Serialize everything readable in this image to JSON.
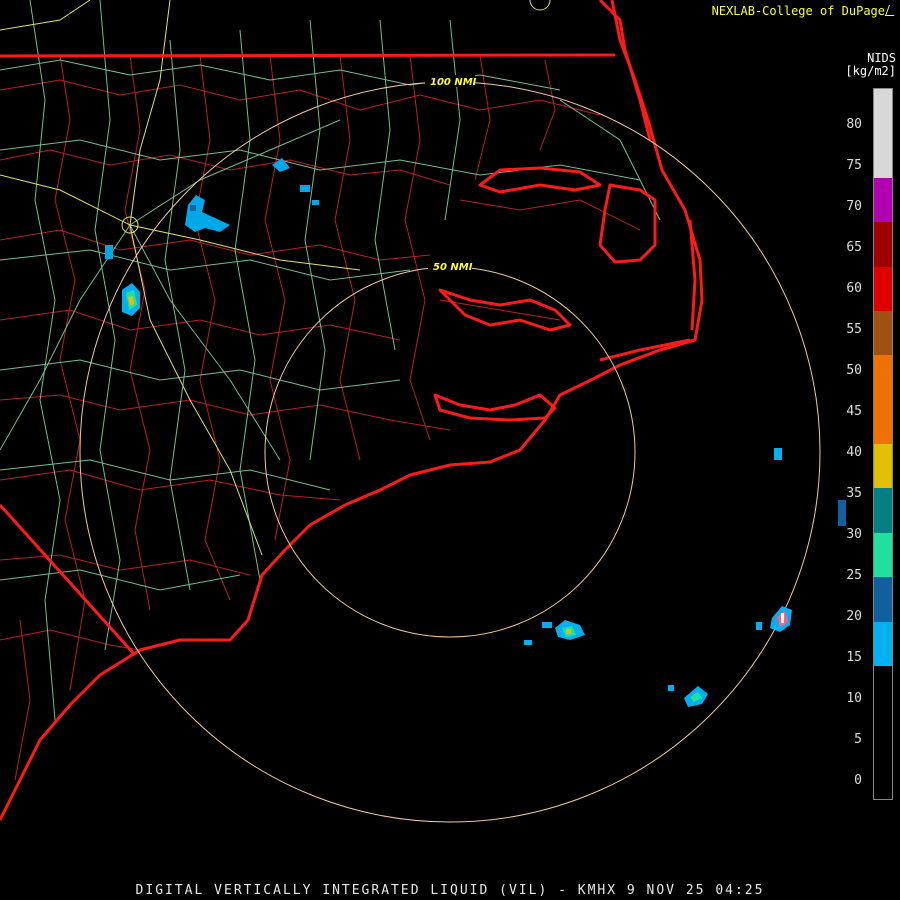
{
  "credit": {
    "text": "NEXLAB-College of DuPage",
    "logo_icon": "nexlab-logo-icon"
  },
  "legend": {
    "product": "NIDS",
    "units": "[kg/m2]",
    "ticks": [
      "80",
      "75",
      "70",
      "65",
      "60",
      "55",
      "50",
      "45",
      "40",
      "35",
      "30",
      "25",
      "20",
      "15",
      "10",
      "5",
      "0"
    ],
    "colors": [
      "#d8d8d8",
      "#b000b0",
      "#a00000",
      "#e00000",
      "#a05010",
      "#f07000",
      "#e0c000",
      "#008080",
      "#20e0a0",
      "#1060a0",
      "#00b0f0",
      "#000000"
    ]
  },
  "range_rings": [
    {
      "label": "50 NMI"
    },
    {
      "label": "100 NMI"
    }
  ],
  "footer": {
    "text": "DIGITAL VERTICALLY INTEGRATED LIQUID (VIL) - KMHX 9 NOV 25 04:25"
  },
  "colors": {
    "coast": "#ff2020",
    "county": "#cc2222",
    "roads": "#88ddaa",
    "highway": "#dddd66",
    "ring": "#f0c8a0"
  }
}
